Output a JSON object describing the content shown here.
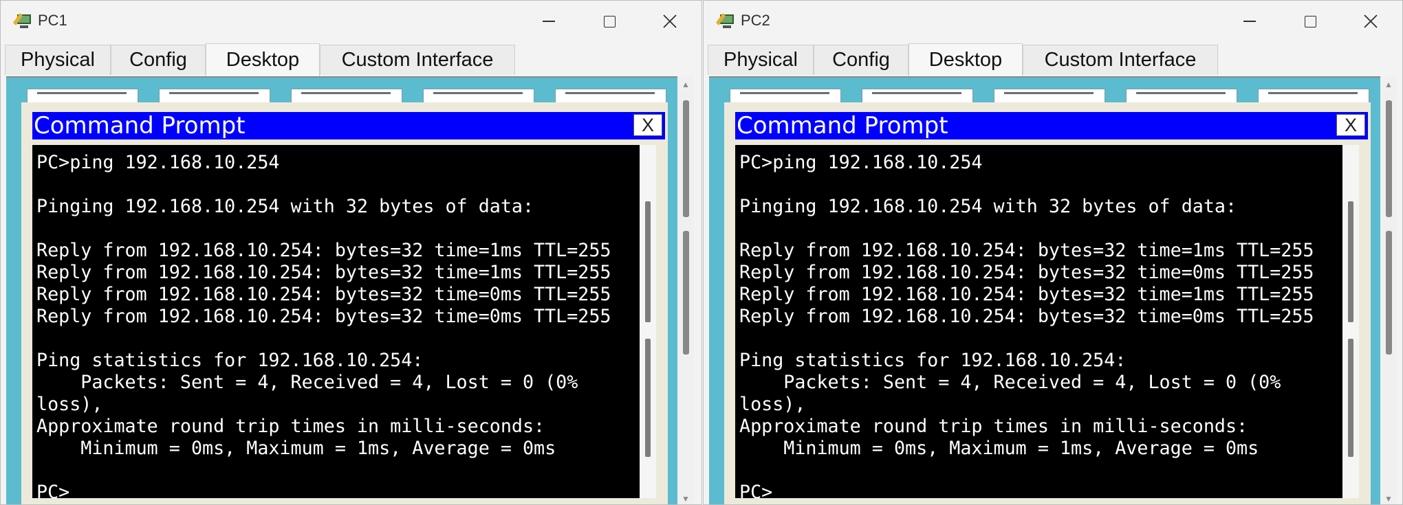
{
  "windows": [
    {
      "id": "pc1",
      "title": "PC1",
      "tabs": [
        "Physical",
        "Config",
        "Desktop",
        "Custom Interface"
      ],
      "active_tab": "Desktop",
      "cmd_title": "Command Prompt",
      "cmd_close": "X",
      "lines": [
        "PC>ping 192.168.10.254",
        "",
        "Pinging 192.168.10.254 with 32 bytes of data:",
        "",
        "Reply from 192.168.10.254: bytes=32 time=1ms TTL=255",
        "Reply from 192.168.10.254: bytes=32 time=1ms TTL=255",
        "Reply from 192.168.10.254: bytes=32 time=0ms TTL=255",
        "Reply from 192.168.10.254: bytes=32 time=0ms TTL=255",
        "",
        "Ping statistics for 192.168.10.254:",
        "    Packets: Sent = 4, Received = 4, Lost = 0 (0%",
        "loss),",
        "Approximate round trip times in milli-seconds:",
        "    Minimum = 0ms, Maximum = 1ms, Average = 0ms",
        "",
        "PC>"
      ]
    },
    {
      "id": "pc2",
      "title": "PC2",
      "tabs": [
        "Physical",
        "Config",
        "Desktop",
        "Custom Interface"
      ],
      "active_tab": "Desktop",
      "cmd_title": "Command Prompt",
      "cmd_close": "X",
      "lines": [
        "PC>ping 192.168.10.254",
        "",
        "Pinging 192.168.10.254 with 32 bytes of data:",
        "",
        "Reply from 192.168.10.254: bytes=32 time=1ms TTL=255",
        "Reply from 192.168.10.254: bytes=32 time=0ms TTL=255",
        "Reply from 192.168.10.254: bytes=32 time=1ms TTL=255",
        "Reply from 192.168.10.254: bytes=32 time=0ms TTL=255",
        "",
        "Ping statistics for 192.168.10.254:",
        "    Packets: Sent = 4, Received = 4, Lost = 0 (0%",
        "loss),",
        "Approximate round trip times in milli-seconds:",
        "    Minimum = 0ms, Maximum = 1ms, Average = 0ms",
        "",
        "PC>"
      ]
    }
  ],
  "colors": {
    "desktop_bg": "#5bbcd0",
    "cmd_header": "#0000ff",
    "terminal_bg": "#000000",
    "terminal_fg": "#ffffff"
  },
  "icons": [
    "app-icon",
    "minimize-icon",
    "maximize-icon",
    "close-icon"
  ]
}
